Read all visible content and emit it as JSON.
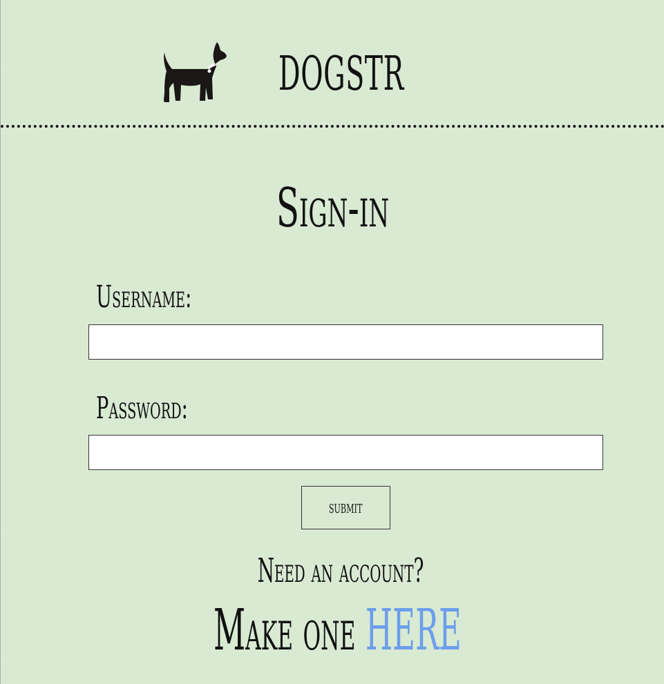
{
  "header": {
    "logo_icon": "dog-icon",
    "brand": "DOGSTR"
  },
  "form": {
    "title": "Sign-in",
    "username_label": "Username:",
    "username_value": "",
    "username_placeholder": "",
    "password_label": "Password:",
    "password_value": "",
    "password_placeholder": "",
    "submit_label": "submit"
  },
  "footer": {
    "need_account": "Need an account?",
    "make_one": "Make one ",
    "here_link": "HERE"
  },
  "colors": {
    "background": "#d9ead3",
    "link": "#6d9eeb"
  }
}
